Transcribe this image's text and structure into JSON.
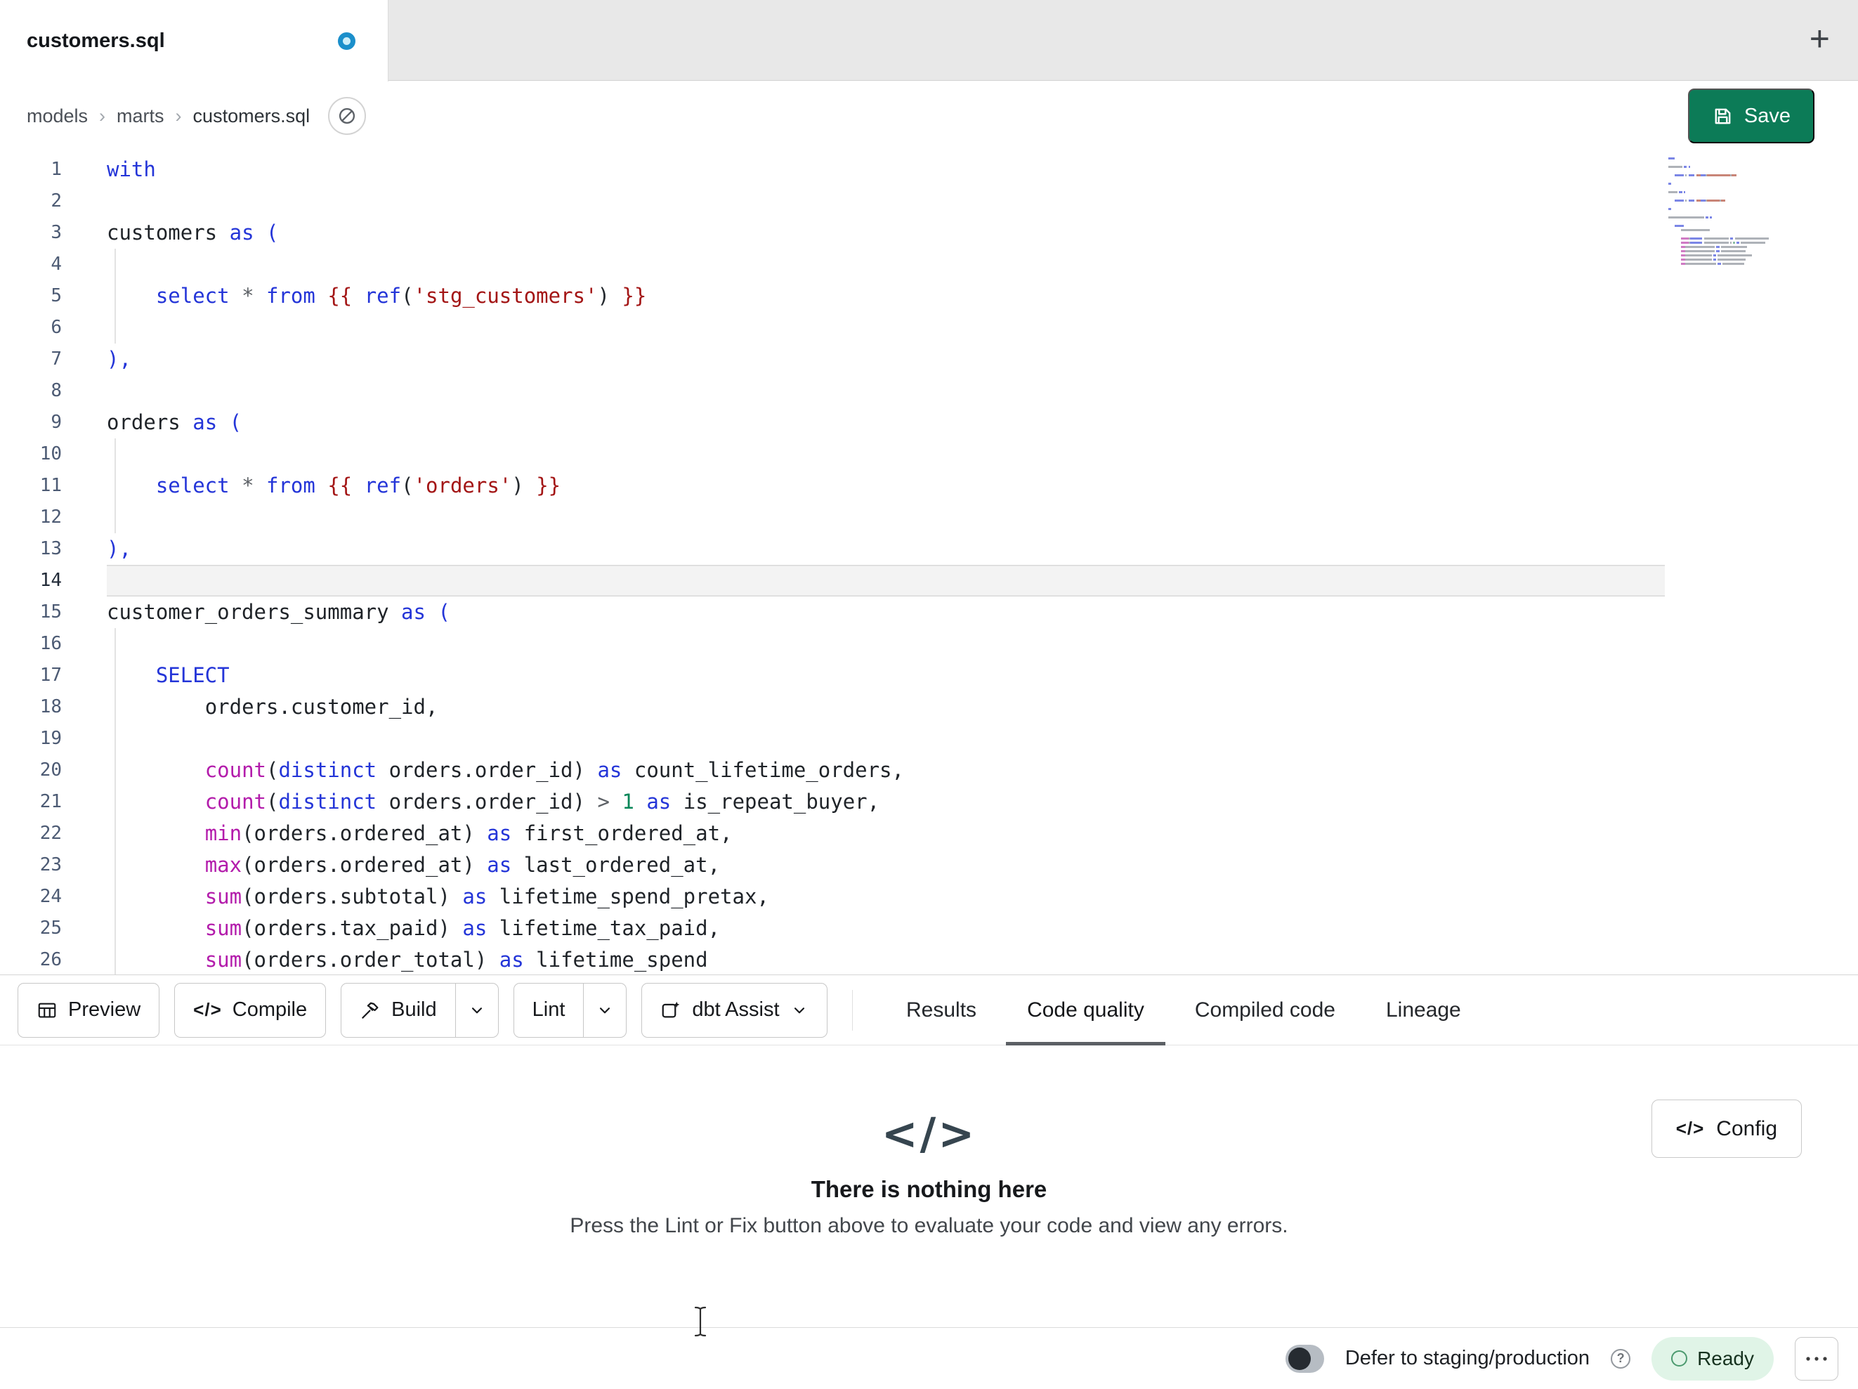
{
  "window": {
    "tab_title": "customers.sql"
  },
  "icons": {
    "plus": "+",
    "code_glyph": "</>",
    "question": "?",
    "crumb_separator": "›"
  },
  "breadcrumb": {
    "items": [
      "models",
      "marts",
      "customers.sql"
    ]
  },
  "header": {
    "save_label": "Save"
  },
  "editor": {
    "active_line": 14,
    "lines": [
      {
        "n": 1,
        "tokens": [
          [
            "with",
            "kw"
          ]
        ]
      },
      {
        "n": 2,
        "tokens": []
      },
      {
        "n": 3,
        "tokens": [
          [
            "customers",
            "id"
          ],
          [
            " ",
            ""
          ],
          [
            "as",
            "kw"
          ],
          [
            " ",
            ""
          ],
          [
            "(",
            "br"
          ]
        ]
      },
      {
        "n": 4,
        "tokens": []
      },
      {
        "n": 5,
        "tokens": [
          [
            "    ",
            ""
          ],
          [
            "select",
            "kw"
          ],
          [
            " ",
            ""
          ],
          [
            "*",
            "op"
          ],
          [
            " ",
            ""
          ],
          [
            "from",
            "kw"
          ],
          [
            " ",
            ""
          ],
          [
            "{{ ",
            "jinja"
          ],
          [
            "ref",
            "kw"
          ],
          [
            "(",
            "pun"
          ],
          [
            "'stg_customers'",
            "str"
          ],
          [
            ")",
            "pun"
          ],
          [
            " }}",
            "jinja"
          ]
        ]
      },
      {
        "n": 6,
        "tokens": []
      },
      {
        "n": 7,
        "tokens": [
          [
            "),",
            "br"
          ]
        ]
      },
      {
        "n": 8,
        "tokens": []
      },
      {
        "n": 9,
        "tokens": [
          [
            "orders",
            "id"
          ],
          [
            " ",
            ""
          ],
          [
            "as",
            "kw"
          ],
          [
            " ",
            ""
          ],
          [
            "(",
            "br"
          ]
        ]
      },
      {
        "n": 10,
        "tokens": []
      },
      {
        "n": 11,
        "tokens": [
          [
            "    ",
            ""
          ],
          [
            "select",
            "kw"
          ],
          [
            " ",
            ""
          ],
          [
            "*",
            "op"
          ],
          [
            " ",
            ""
          ],
          [
            "from",
            "kw"
          ],
          [
            " ",
            ""
          ],
          [
            "{{ ",
            "jinja"
          ],
          [
            "ref",
            "kw"
          ],
          [
            "(",
            "pun"
          ],
          [
            "'orders'",
            "str"
          ],
          [
            ")",
            "pun"
          ],
          [
            " }}",
            "jinja"
          ]
        ]
      },
      {
        "n": 12,
        "tokens": []
      },
      {
        "n": 13,
        "tokens": [
          [
            "),",
            "br"
          ]
        ]
      },
      {
        "n": 14,
        "tokens": []
      },
      {
        "n": 15,
        "tokens": [
          [
            "customer_orders_summary",
            "id"
          ],
          [
            " ",
            ""
          ],
          [
            "as",
            "kw"
          ],
          [
            " ",
            ""
          ],
          [
            "(",
            "br"
          ]
        ]
      },
      {
        "n": 16,
        "tokens": []
      },
      {
        "n": 17,
        "tokens": [
          [
            "    ",
            ""
          ],
          [
            "SELECT",
            "kw"
          ]
        ]
      },
      {
        "n": 18,
        "tokens": [
          [
            "        ",
            ""
          ],
          [
            "orders.customer_id,",
            "id"
          ]
        ]
      },
      {
        "n": 19,
        "tokens": []
      },
      {
        "n": 20,
        "tokens": [
          [
            "        ",
            ""
          ],
          [
            "count",
            "fn"
          ],
          [
            "(",
            "pun"
          ],
          [
            "distinct",
            "kw"
          ],
          [
            " ",
            ""
          ],
          [
            "orders.order_id",
            "id"
          ],
          [
            ")",
            "pun"
          ],
          [
            " ",
            ""
          ],
          [
            "as",
            "kw"
          ],
          [
            " ",
            ""
          ],
          [
            "count_lifetime_orders,",
            "id"
          ]
        ]
      },
      {
        "n": 21,
        "tokens": [
          [
            "        ",
            ""
          ],
          [
            "count",
            "fn"
          ],
          [
            "(",
            "pun"
          ],
          [
            "distinct",
            "kw"
          ],
          [
            " ",
            ""
          ],
          [
            "orders.order_id",
            "id"
          ],
          [
            ")",
            "pun"
          ],
          [
            " ",
            ""
          ],
          [
            ">",
            "op"
          ],
          [
            " ",
            ""
          ],
          [
            "1",
            "num"
          ],
          [
            " ",
            ""
          ],
          [
            "as",
            "kw"
          ],
          [
            " ",
            ""
          ],
          [
            "is_repeat_buyer,",
            "id"
          ]
        ]
      },
      {
        "n": 22,
        "tokens": [
          [
            "        ",
            ""
          ],
          [
            "min",
            "fn"
          ],
          [
            "(",
            "pun"
          ],
          [
            "orders.ordered_at",
            "id"
          ],
          [
            ")",
            "pun"
          ],
          [
            " ",
            ""
          ],
          [
            "as",
            "kw"
          ],
          [
            " ",
            ""
          ],
          [
            "first_ordered_at,",
            "id"
          ]
        ]
      },
      {
        "n": 23,
        "tokens": [
          [
            "        ",
            ""
          ],
          [
            "max",
            "fn"
          ],
          [
            "(",
            "pun"
          ],
          [
            "orders.ordered_at",
            "id"
          ],
          [
            ")",
            "pun"
          ],
          [
            " ",
            ""
          ],
          [
            "as",
            "kw"
          ],
          [
            " ",
            ""
          ],
          [
            "last_ordered_at,",
            "id"
          ]
        ]
      },
      {
        "n": 24,
        "tokens": [
          [
            "        ",
            ""
          ],
          [
            "sum",
            "fn"
          ],
          [
            "(",
            "pun"
          ],
          [
            "orders.subtotal",
            "id"
          ],
          [
            ")",
            "pun"
          ],
          [
            " ",
            ""
          ],
          [
            "as",
            "kw"
          ],
          [
            " ",
            ""
          ],
          [
            "lifetime_spend_pretax,",
            "id"
          ]
        ]
      },
      {
        "n": 25,
        "tokens": [
          [
            "        ",
            ""
          ],
          [
            "sum",
            "fn"
          ],
          [
            "(",
            "pun"
          ],
          [
            "orders.tax_paid",
            "id"
          ],
          [
            ")",
            "pun"
          ],
          [
            " ",
            ""
          ],
          [
            "as",
            "kw"
          ],
          [
            " ",
            ""
          ],
          [
            "lifetime_tax_paid,",
            "id"
          ]
        ]
      },
      {
        "n": 26,
        "tokens": [
          [
            "        ",
            ""
          ],
          [
            "sum",
            "fn"
          ],
          [
            "(",
            "pun"
          ],
          [
            "orders.order_total",
            "id"
          ],
          [
            ")",
            "pun"
          ],
          [
            " ",
            ""
          ],
          [
            "as",
            "kw"
          ],
          [
            " ",
            ""
          ],
          [
            "lifetime_spend",
            "id"
          ]
        ]
      }
    ]
  },
  "toolbar": {
    "preview": "Preview",
    "compile": "Compile",
    "build": "Build",
    "lint": "Lint",
    "assist": "dbt Assist"
  },
  "panel_tabs": [
    {
      "label": "Results",
      "active": false
    },
    {
      "label": "Code quality",
      "active": true
    },
    {
      "label": "Compiled code",
      "active": false
    },
    {
      "label": "Lineage",
      "active": false
    }
  ],
  "empty_state": {
    "icon": "</>",
    "title": "There is nothing here",
    "subtitle": "Press the Lint or Fix button above to evaluate your code and view any errors.",
    "config_label": "Config"
  },
  "status_bar": {
    "defer_label": "Defer to staging/production",
    "ready_label": "Ready"
  },
  "colors": {
    "save_button": "#0c7b57",
    "keyword": "#2435d8",
    "function": "#b31cab",
    "string": "#a31515",
    "ready_badge_bg": "#e0f4e7",
    "unsaved_dot": "#1b8fcb",
    "active_line_bg": "#f3f3f3"
  }
}
